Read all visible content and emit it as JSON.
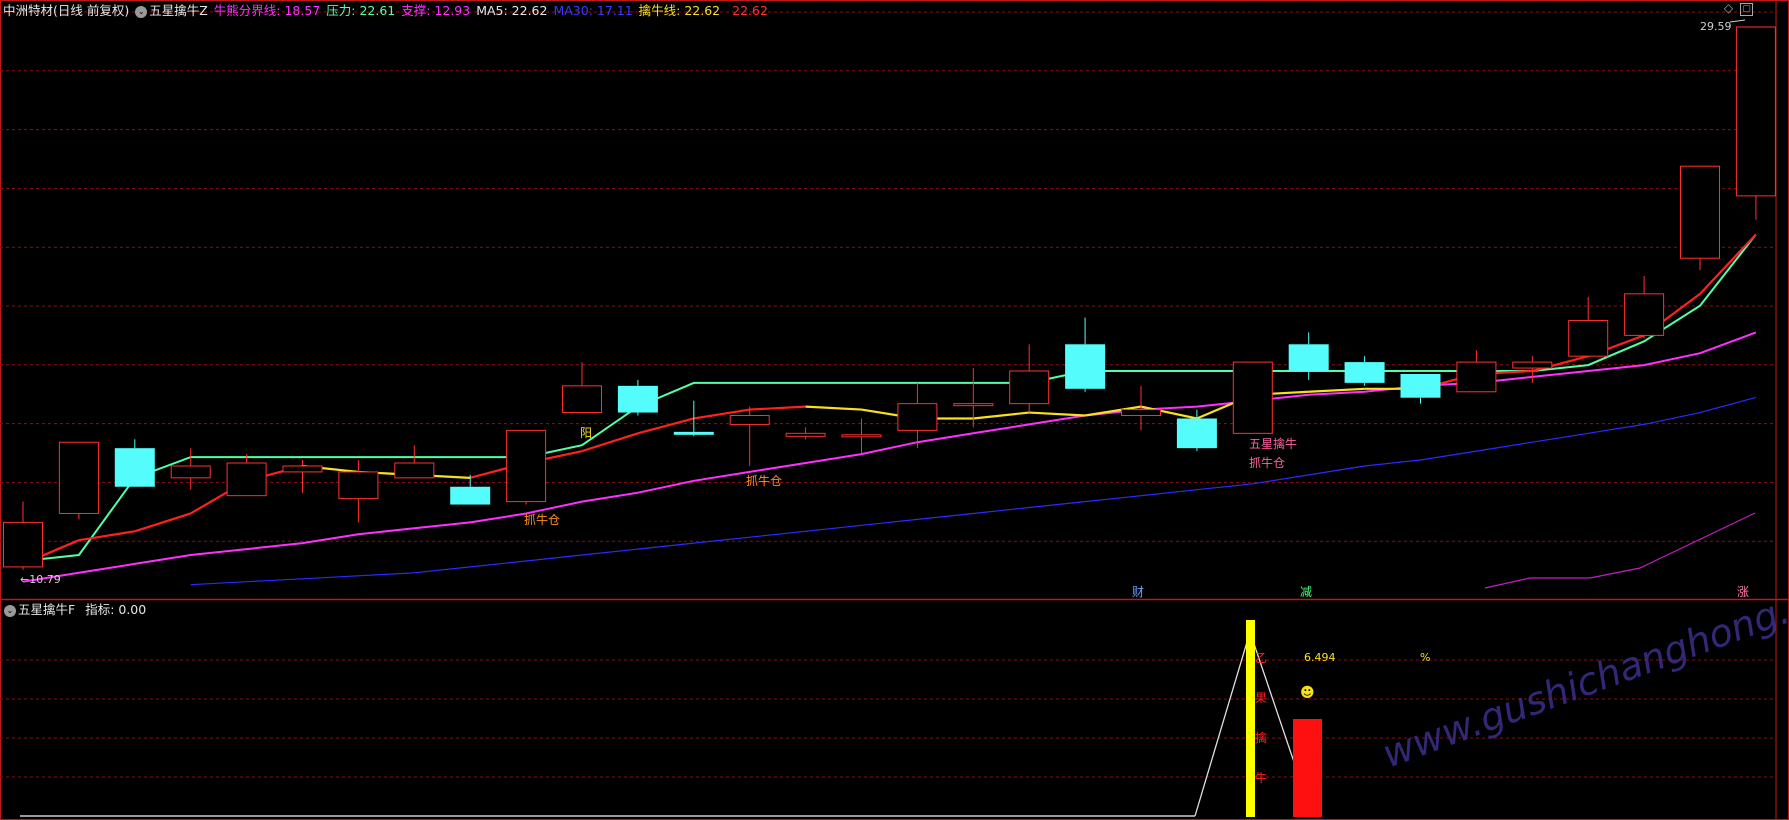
{
  "colors": {
    "bg": "#000000",
    "grid": "#8a1010",
    "frame": "#c01818",
    "up": "#ff3030",
    "down": "#54fcfc",
    "ma5": "#ffffff",
    "ma30": "#2b2bff",
    "support": "#ff30ff",
    "pressure": "#50ffa8",
    "line_red": "#ff2020",
    "line_yellow": "#f8e020",
    "yellow_bar": "#ffff00"
  },
  "header": {
    "stock_name": "中洲特材(日线 前复权)",
    "indicator_name": "五星擒牛Z",
    "boundary_label": "牛熊分界线: 18.57",
    "pressure_label": "压力: 22.61",
    "support_label": "支撑: 12.93",
    "ma5_label": "MA5: 22.62",
    "ma30_label": "MA30: 17.11",
    "bull_line_label": "擒牛线: 22.62",
    "extra_value": "22.62",
    "icons": {
      "collapse": "circle-chevron-icon",
      "window": "window-icons"
    }
  },
  "sub_header": {
    "indicator_name": "五星擒牛F",
    "value_label": "指标: 0.00"
  },
  "annotations": {
    "high_label": "29.59",
    "low_label": "←10.79",
    "yang_label": "阳",
    "zhuaniucang": "抓牛仓",
    "wuxingqinniu": "五星擒牛",
    "cai": "财",
    "jian": "减",
    "zhang": "涨",
    "sub_value": "6.494",
    "percent": "%",
    "smiley": "☻",
    "vertical_chars": [
      "乙",
      "果",
      "擒",
      "牛"
    ],
    "watermark": "www.gushichanghong.com"
  },
  "chart_data": {
    "type": "candlestick",
    "price_range": [
      10.79,
      29.59
    ],
    "candles": [
      {
        "o": 11.4,
        "c": 12.9,
        "h": 13.6,
        "l": 11.3
      },
      {
        "o": 13.2,
        "c": 15.6,
        "h": 15.6,
        "l": 13.0
      },
      {
        "o": 15.4,
        "c": 14.1,
        "h": 15.7,
        "l": 14.1
      },
      {
        "o": 14.4,
        "c": 14.8,
        "h": 15.4,
        "l": 14.0
      },
      {
        "o": 13.8,
        "c": 14.9,
        "h": 15.2,
        "l": 13.8
      },
      {
        "o": 14.6,
        "c": 14.8,
        "h": 15.0,
        "l": 13.9
      },
      {
        "o": 13.7,
        "c": 14.6,
        "h": 15.0,
        "l": 12.9
      },
      {
        "o": 14.4,
        "c": 14.9,
        "h": 15.5,
        "l": 14.4
      },
      {
        "o": 14.1,
        "c": 13.5,
        "h": 14.5,
        "l": 13.5
      },
      {
        "o": 13.6,
        "c": 16.0,
        "h": 16.0,
        "l": 13.5
      },
      {
        "o": 16.6,
        "c": 17.5,
        "h": 18.3,
        "l": 16.6
      },
      {
        "o": 17.5,
        "c": 16.6,
        "h": 17.7,
        "l": 16.5
      },
      {
        "o": 15.95,
        "c": 15.85,
        "h": 17.0,
        "l": 15.8
      },
      {
        "o": 16.2,
        "c": 16.5,
        "h": 16.8,
        "l": 14.8
      },
      {
        "o": 15.8,
        "c": 15.9,
        "h": 16.1,
        "l": 15.7
      },
      {
        "o": 15.8,
        "c": 15.85,
        "h": 16.4,
        "l": 15.2
      },
      {
        "o": 16.0,
        "c": 16.9,
        "h": 17.6,
        "l": 15.4
      },
      {
        "o": 16.9,
        "c": 16.9,
        "h": 18.1,
        "l": 16.1
      },
      {
        "o": 16.9,
        "c": 18.0,
        "h": 18.9,
        "l": 16.6
      },
      {
        "o": 18.9,
        "c": 17.4,
        "h": 19.8,
        "l": 17.3
      },
      {
        "o": 16.5,
        "c": 16.7,
        "h": 17.5,
        "l": 16.0
      },
      {
        "o": 16.4,
        "c": 15.4,
        "h": 16.7,
        "l": 15.3
      },
      {
        "o": 15.9,
        "c": 18.3,
        "h": 18.3,
        "l": 15.9
      },
      {
        "o": 18.9,
        "c": 18.0,
        "h": 19.3,
        "l": 17.7
      },
      {
        "o": 18.3,
        "c": 17.6,
        "h": 18.5,
        "l": 17.5
      },
      {
        "o": 17.9,
        "c": 17.1,
        "h": 17.9,
        "l": 16.9
      },
      {
        "o": 17.3,
        "c": 18.3,
        "h": 18.7,
        "l": 17.3
      },
      {
        "o": 18.1,
        "c": 18.3,
        "h": 18.5,
        "l": 17.6
      },
      {
        "o": 18.5,
        "c": 19.7,
        "h": 20.5,
        "l": 18.5
      },
      {
        "o": 19.2,
        "c": 20.6,
        "h": 21.2,
        "l": 19.1
      },
      {
        "o": 21.8,
        "c": 24.9,
        "h": 24.9,
        "l": 21.4
      },
      {
        "o": 23.9,
        "c": 29.59,
        "h": 29.59,
        "l": 23.1
      }
    ],
    "bull_line": [
      11.5,
      12.3,
      12.6,
      13.2,
      14.3,
      14.8,
      14.6,
      14.5,
      14.4,
      14.9,
      15.3,
      15.9,
      16.4,
      16.7,
      16.8,
      16.7,
      16.4,
      16.4,
      16.6,
      16.5,
      16.8,
      16.4,
      17.2,
      17.3,
      17.4,
      17.4,
      17.9,
      18.0,
      18.5,
      19.2,
      20.6,
      22.6
    ],
    "pressure_line": [
      11.6,
      11.8,
      14.4,
      15.1,
      15.1,
      15.1,
      15.1,
      15.1,
      15.1,
      15.1,
      15.5,
      16.8,
      17.6,
      17.6,
      17.6,
      17.6,
      17.6,
      17.6,
      17.6,
      18.0,
      18.0,
      18.0,
      18.0,
      18.0,
      18.0,
      18.0,
      18.0,
      18.0,
      18.2,
      19.0,
      20.2,
      22.6
    ],
    "support_line": [
      10.9,
      11.2,
      11.5,
      11.8,
      12.0,
      12.2,
      12.5,
      12.7,
      12.9,
      13.2,
      13.6,
      13.9,
      14.3,
      14.6,
      14.9,
      15.2,
      15.6,
      15.9,
      16.2,
      16.5,
      16.7,
      16.8,
      17.0,
      17.2,
      17.3,
      17.5,
      17.6,
      17.8,
      18.0,
      18.2,
      18.6,
      19.3
    ],
    "ma30": [
      null,
      null,
      null,
      10.8,
      10.9,
      11.0,
      11.1,
      11.2,
      11.4,
      11.6,
      11.8,
      12.0,
      12.2,
      12.4,
      12.6,
      12.8,
      13.0,
      13.2,
      13.4,
      13.6,
      13.8,
      14.0,
      14.2,
      14.5,
      14.8,
      15.0,
      15.3,
      15.6,
      15.9,
      16.2,
      16.6,
      17.11
    ],
    "sub_chart": {
      "value": 0.0,
      "annotation_value": 6.494,
      "yellow_bar_index": 22,
      "red_bar_index": 23
    }
  }
}
